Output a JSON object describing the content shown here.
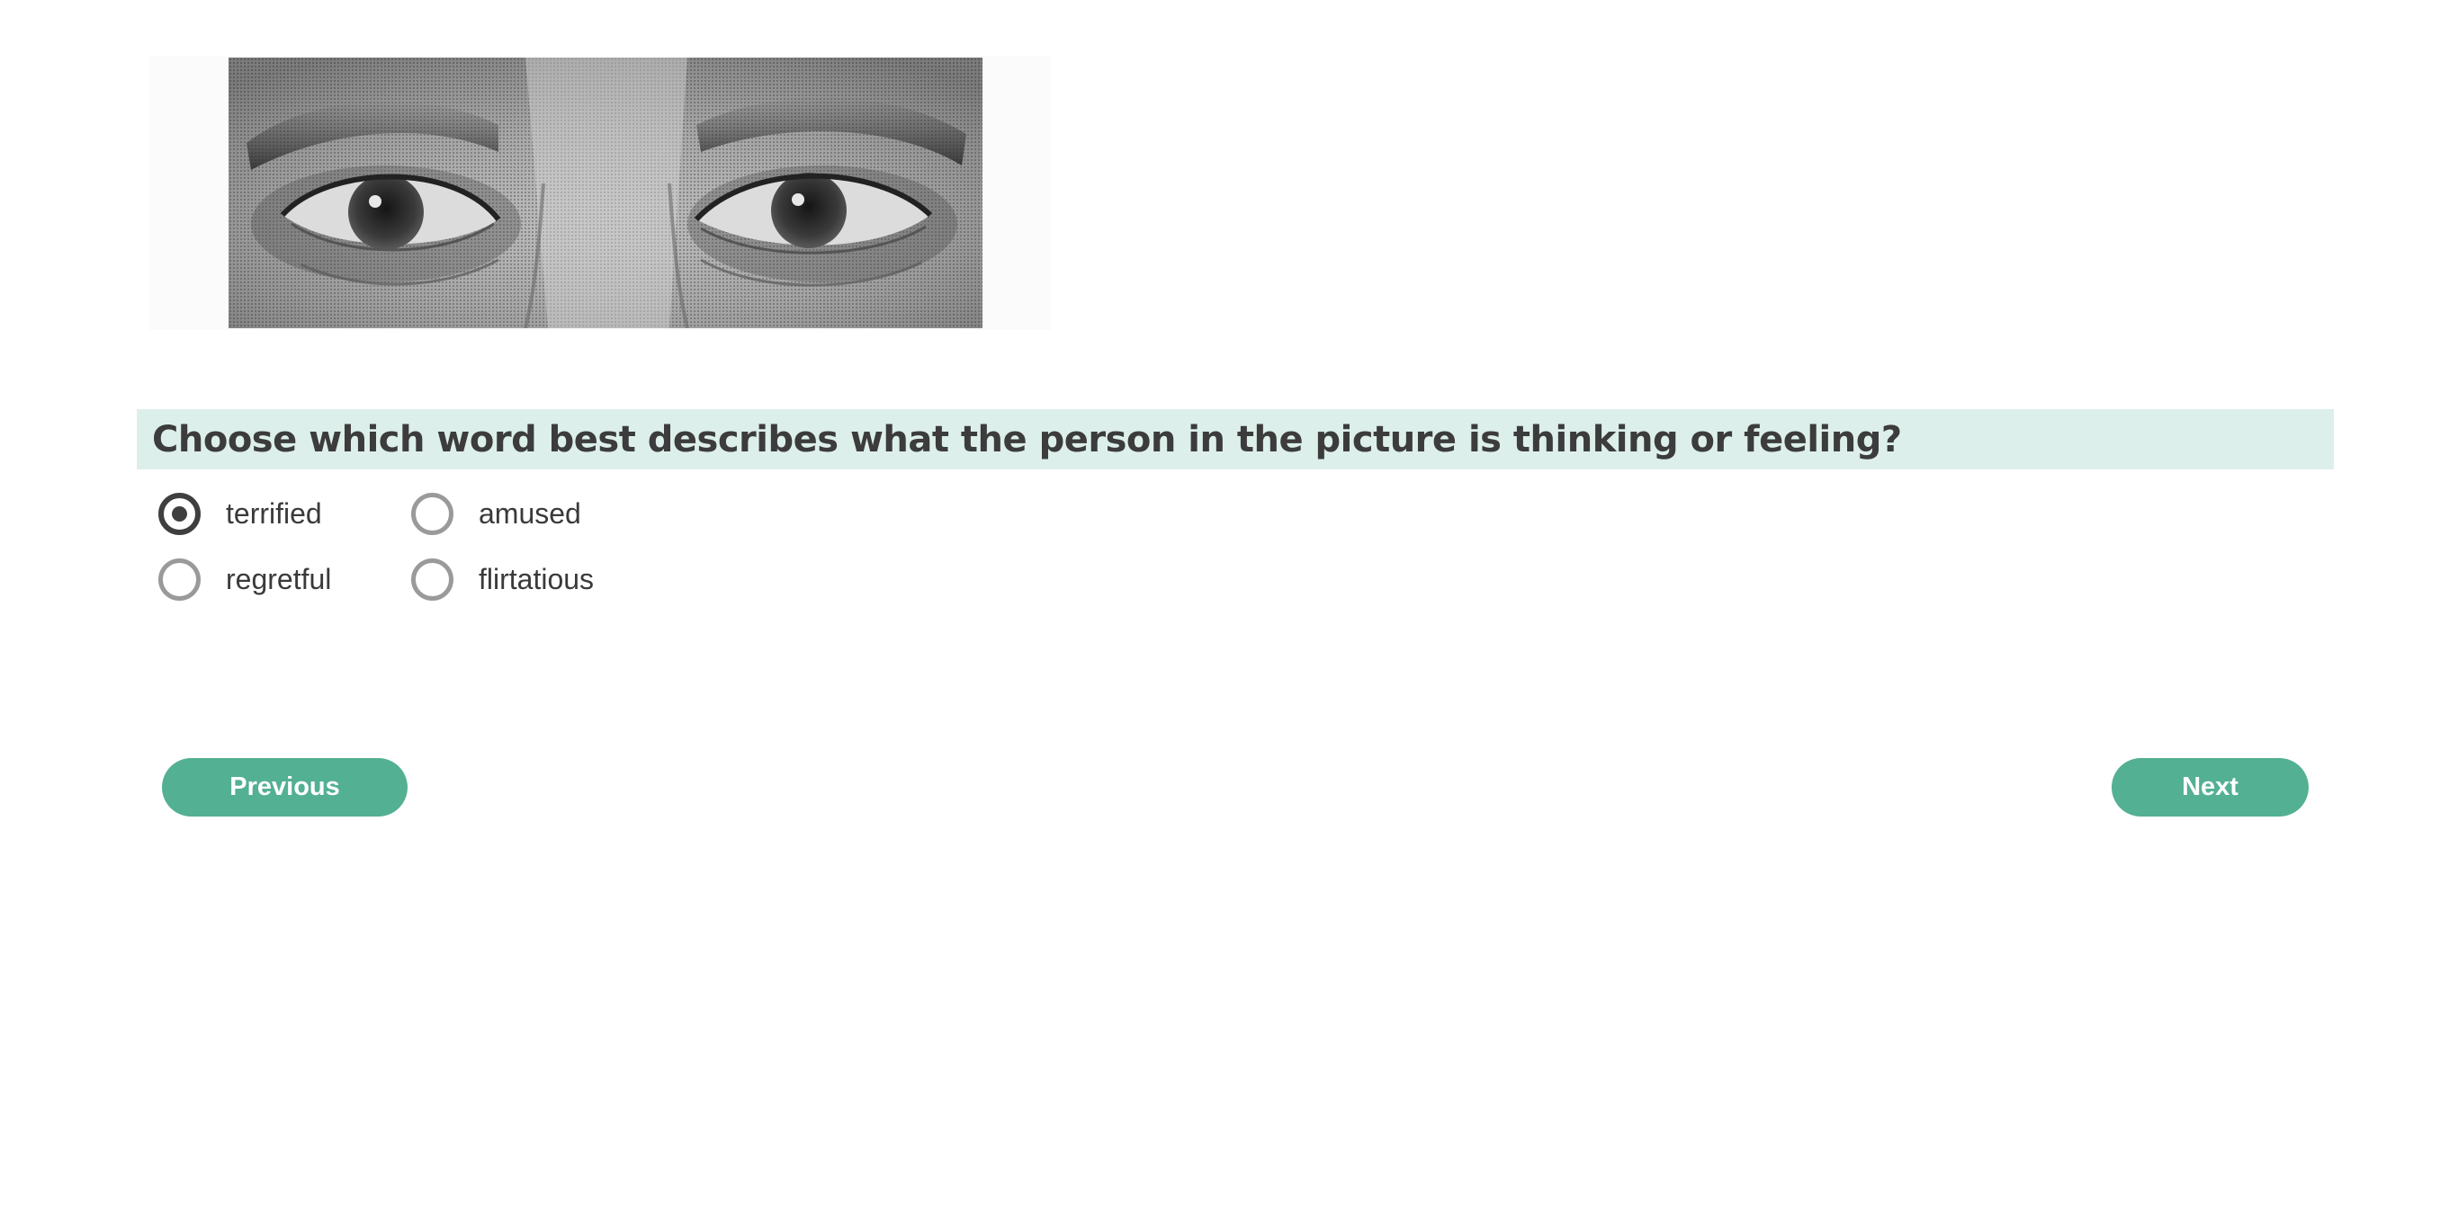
{
  "stimulus": {
    "image": "eyes-photo-grayscale"
  },
  "question": {
    "text": "Choose which word best describes what the person in the picture is thinking or feeling?"
  },
  "options": [
    {
      "label": "terrified",
      "selected": true
    },
    {
      "label": "amused",
      "selected": false
    },
    {
      "label": "regretful",
      "selected": false
    },
    {
      "label": "flirtatious",
      "selected": false
    }
  ],
  "navigation": {
    "previous_label": "Previous",
    "next_label": "Next"
  },
  "colors": {
    "accent": "#53b093",
    "question_bar": "#ddefea",
    "radio_checked": "#3f3f3f",
    "radio_unchecked": "#9a9a9a"
  }
}
